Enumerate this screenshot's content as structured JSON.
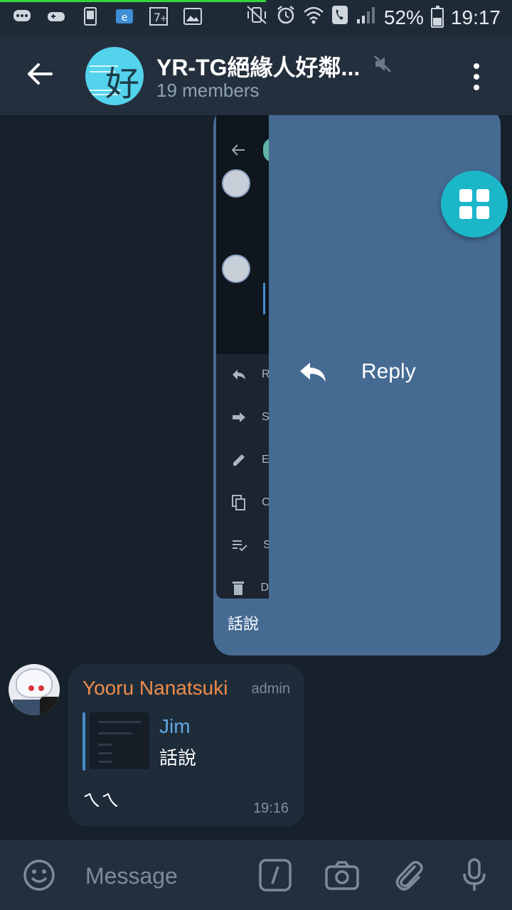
{
  "status_bar": {
    "battery": "52%",
    "time": "19:17",
    "download_progress": 0.52
  },
  "header": {
    "title": "YR-TG絕緣人好鄰...",
    "subtitle": "19 members",
    "icons": [
      "back-arrow-icon",
      "mute-icon",
      "more-vert-icon"
    ]
  },
  "chat": {
    "outgoing": {
      "caption": "話說",
      "swipe_action": "Reply",
      "thumbnail_menu_letters": [
        "R",
        "S",
        "E",
        "C",
        "S",
        "D"
      ]
    },
    "incoming": {
      "sender": "Yooru Nanatsuki",
      "badge": "admin",
      "quote_author": "Jim",
      "quote_text": "話說",
      "text": "ㄟㄟ",
      "time": "19:16"
    }
  },
  "input": {
    "placeholder": "Message"
  },
  "colors": {
    "accent": "#1cb6c9",
    "outgoing_bubble": "#466b93",
    "sender_name": "#ef8c4a",
    "quote_author": "#64a8e3"
  }
}
